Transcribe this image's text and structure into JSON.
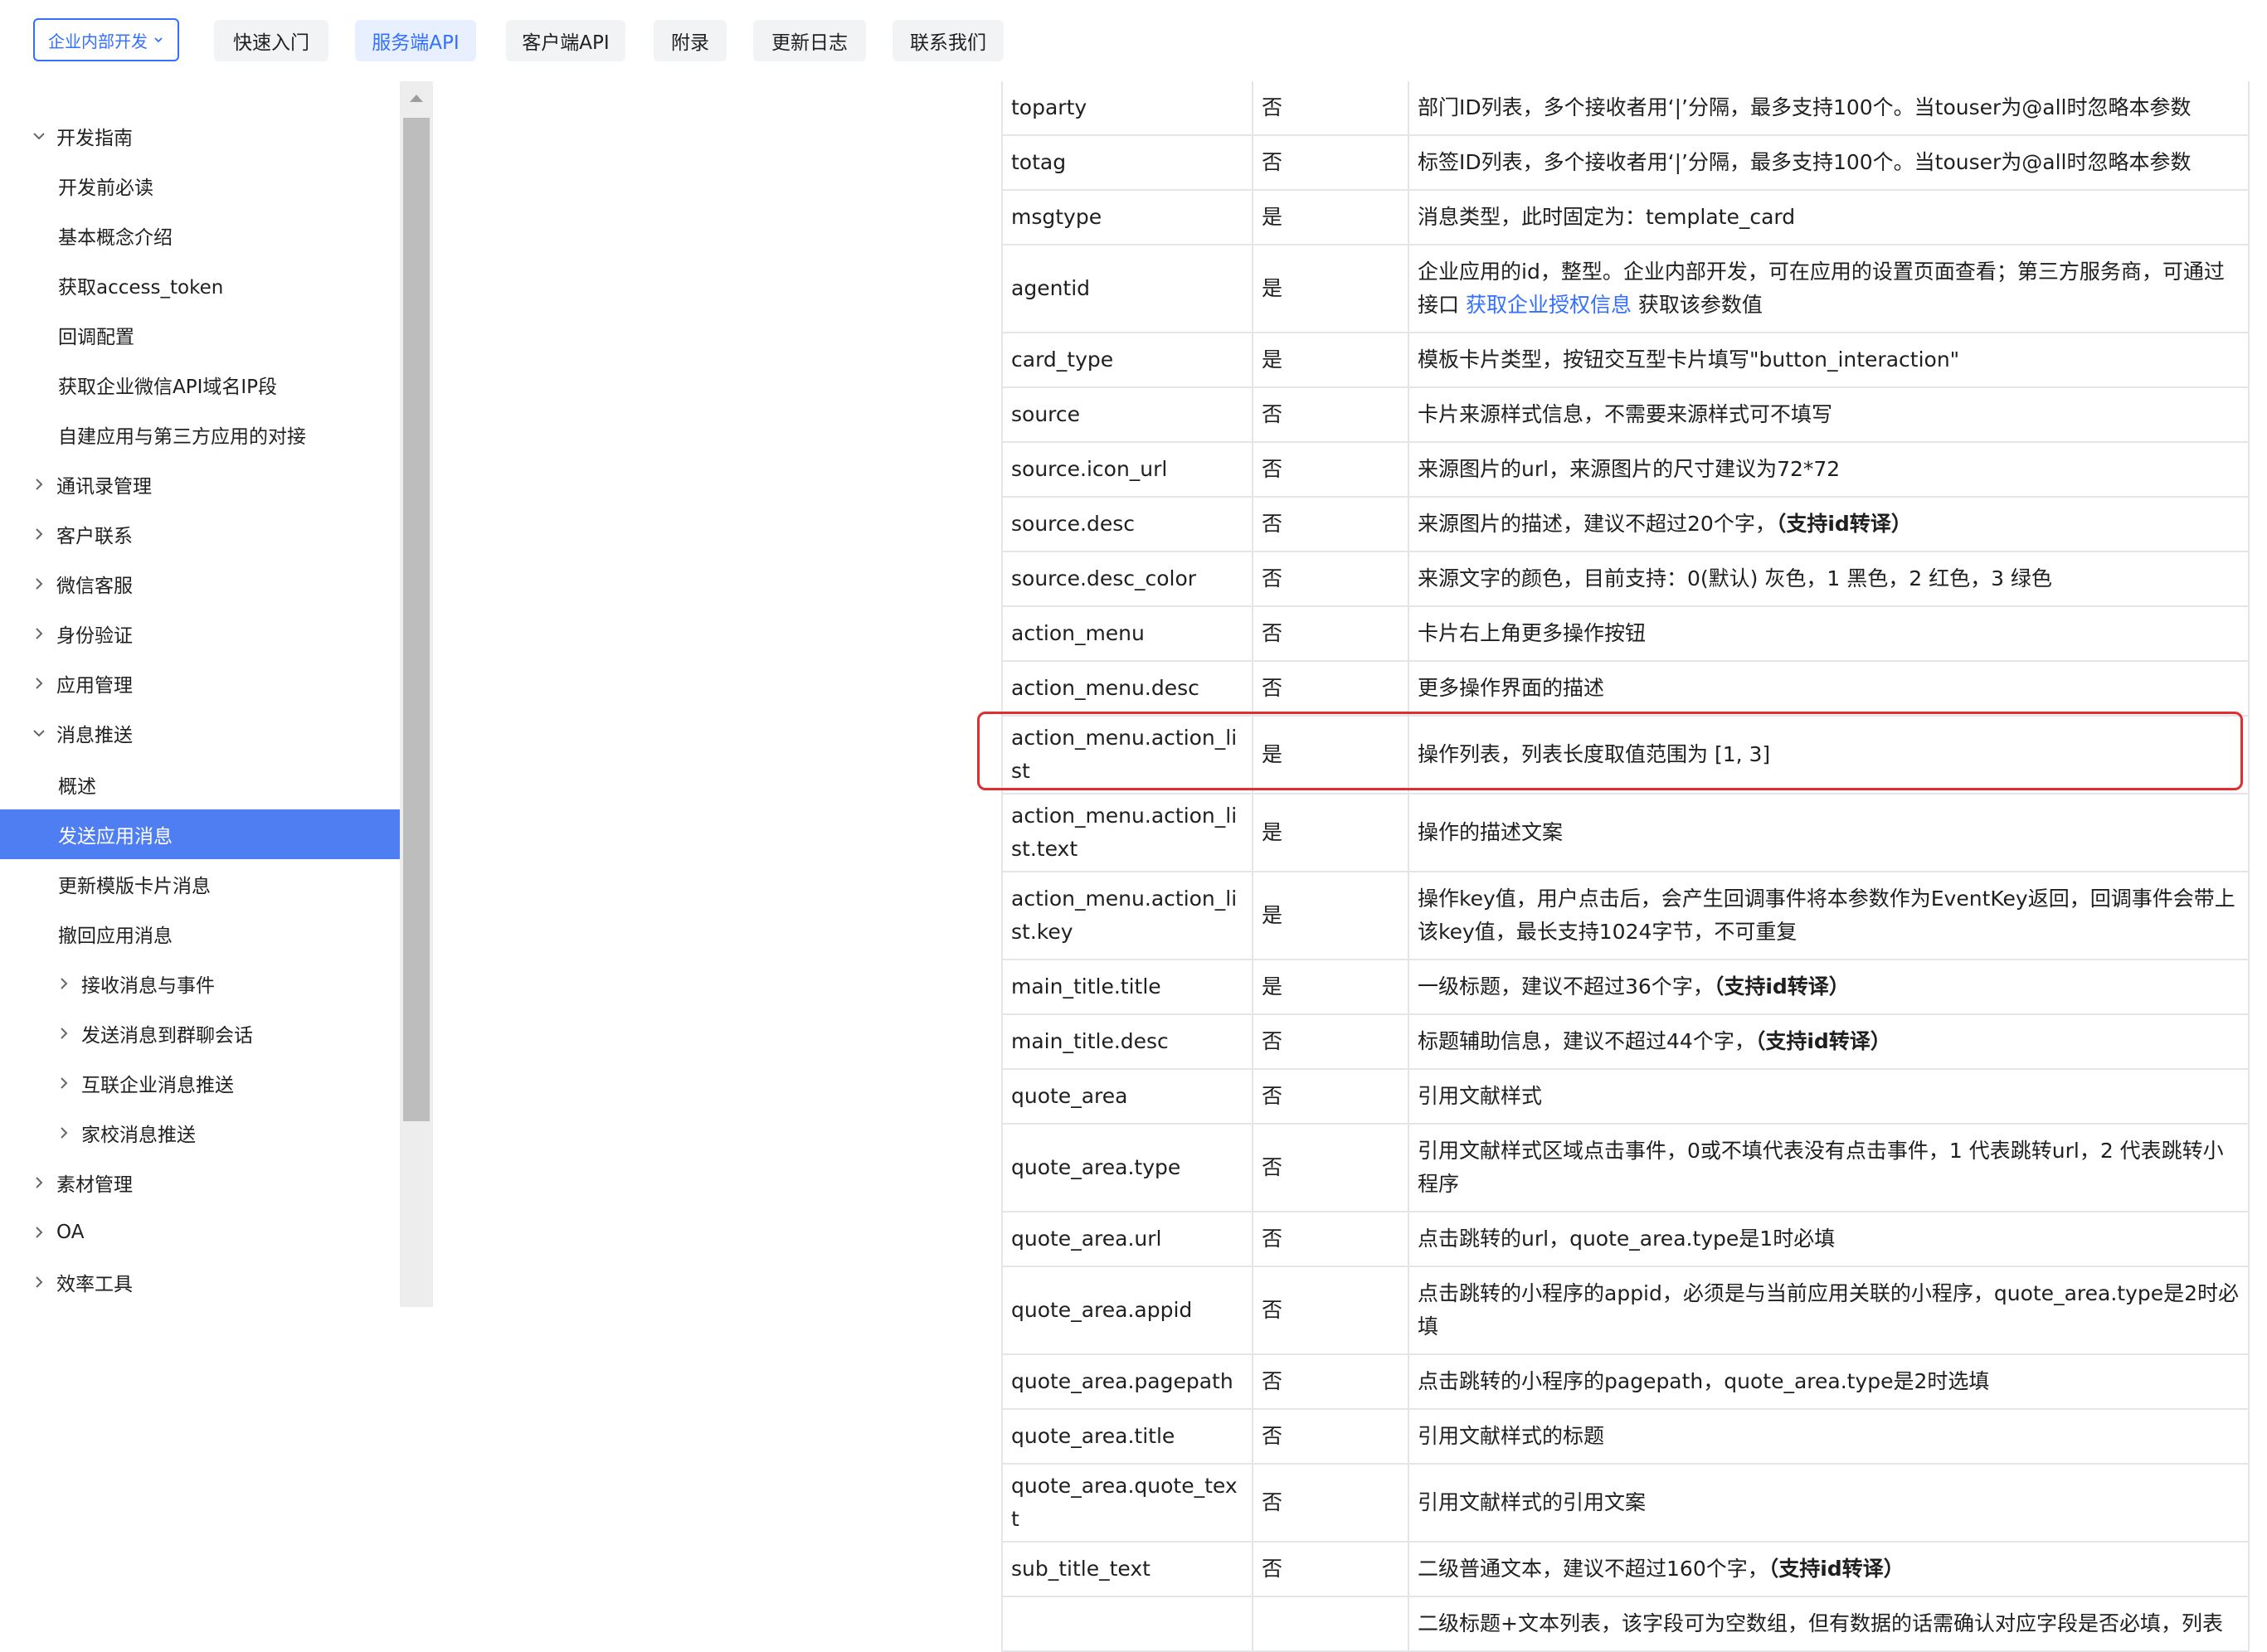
{
  "topnav": {
    "dropdown_label": "企业内部开发",
    "tabs": [
      {
        "label": "快速入门"
      },
      {
        "label": "服务端API"
      },
      {
        "label": "客户端API"
      },
      {
        "label": "附录"
      },
      {
        "label": "更新日志"
      },
      {
        "label": "联系我们"
      }
    ],
    "active_tab": "服务端API"
  },
  "sidebar": {
    "items": [
      {
        "label": "开发指南",
        "expanded": true
      },
      {
        "label": "开发前必读"
      },
      {
        "label": "基本概念介绍"
      },
      {
        "label": "获取access_token"
      },
      {
        "label": "回调配置"
      },
      {
        "label": "获取企业微信API域名IP段"
      },
      {
        "label": "自建应用与第三方应用的对接"
      },
      {
        "label": "通讯录管理",
        "expanded": false
      },
      {
        "label": "客户联系",
        "expanded": false
      },
      {
        "label": "微信客服",
        "expanded": false
      },
      {
        "label": "身份验证",
        "expanded": false
      },
      {
        "label": "应用管理",
        "expanded": false
      },
      {
        "label": "消息推送",
        "expanded": true
      },
      {
        "label": "概述"
      },
      {
        "label": "发送应用消息",
        "selected": true
      },
      {
        "label": "更新模版卡片消息"
      },
      {
        "label": "撤回应用消息"
      },
      {
        "label": "接收消息与事件",
        "expanded": false
      },
      {
        "label": "发送消息到群聊会话",
        "expanded": false
      },
      {
        "label": "互联企业消息推送",
        "expanded": false
      },
      {
        "label": "家校消息推送",
        "expanded": false
      },
      {
        "label": "素材管理",
        "expanded": false
      },
      {
        "label": "OA",
        "expanded": false
      },
      {
        "label": "效率工具",
        "expanded": false
      }
    ]
  },
  "table": {
    "rows": [
      {
        "param": "toparty",
        "required": "否",
        "desc": "部门ID列表，多个接收者用‘|’分隔，最多支持100个。当touser为@all时忽略本参数"
      },
      {
        "param": "totag",
        "required": "否",
        "desc": "标签ID列表，多个接收者用‘|’分隔，最多支持100个。当touser为@all时忽略本参数"
      },
      {
        "param": "msgtype",
        "required": "是",
        "desc": "消息类型，此时固定为：template_card"
      },
      {
        "param": "agentid",
        "required": "是",
        "desc": "企业应用的id，整型。企业内部开发，可在应用的设置页面查看；第三方服务商，可通过接口 ",
        "desc_link": "获取企业授权信息",
        "desc_tail": " 获取该参数值"
      },
      {
        "param": "card_type",
        "required": "是",
        "desc": "模板卡片类型，按钮交互型卡片填写\"button_interaction\""
      },
      {
        "param": "source",
        "required": "否",
        "desc": "卡片来源样式信息，不需要来源样式可不填写"
      },
      {
        "param": "source.icon_url",
        "required": "否",
        "desc": "来源图片的url，来源图片的尺寸建议为72*72"
      },
      {
        "param": "source.desc",
        "required": "否",
        "desc": "来源图片的描述，建议不超过20个字，",
        "desc_bold": "（支持id转译）"
      },
      {
        "param": "source.desc_color",
        "required": "否",
        "desc": "来源文字的颜色，目前支持：0(默认) 灰色，1 黑色，2 红色，3 绿色"
      },
      {
        "param": "action_menu",
        "required": "否",
        "desc": "卡片右上角更多操作按钮"
      },
      {
        "param": "action_menu.desc",
        "required": "否",
        "desc": "更多操作界面的描述"
      },
      {
        "param": "action_menu.action_list",
        "required": "是",
        "desc": "操作列表，列表长度取值范围为 [1, 3]"
      },
      {
        "param": "action_menu.action_list.text",
        "required": "是",
        "desc": "操作的描述文案"
      },
      {
        "param": "action_menu.action_list.key",
        "required": "是",
        "desc": "操作key值，用户点击后，会产生回调事件将本参数作为EventKey返回，回调事件会带上该key值，最长支持1024字节，不可重复",
        "highlighted": true
      },
      {
        "param": "main_title.title",
        "required": "是",
        "desc": "一级标题，建议不超过36个字，",
        "desc_bold": "（支持id转译）"
      },
      {
        "param": "main_title.desc",
        "required": "否",
        "desc": "标题辅助信息，建议不超过44个字，",
        "desc_bold": "（支持id转译）"
      },
      {
        "param": "quote_area",
        "required": "否",
        "desc": "引用文献样式"
      },
      {
        "param": "quote_area.type",
        "required": "否",
        "desc": "引用文献样式区域点击事件，0或不填代表没有点击事件，1 代表跳转url，2 代表跳转小程序"
      },
      {
        "param": "quote_area.url",
        "required": "否",
        "desc": "点击跳转的url，quote_area.type是1时必填"
      },
      {
        "param": "quote_area.appid",
        "required": "否",
        "desc": "点击跳转的小程序的appid，必须是与当前应用关联的小程序，quote_area.type是2时必填"
      },
      {
        "param": "quote_area.pagepath",
        "required": "否",
        "desc": "点击跳转的小程序的pagepath，quote_area.type是2时选填"
      },
      {
        "param": "quote_area.title",
        "required": "否",
        "desc": "引用文献样式的标题"
      },
      {
        "param": "quote_area.quote_text",
        "required": "否",
        "desc": "引用文献样式的引用文案"
      },
      {
        "param": "sub_title_text",
        "required": "否",
        "desc": "二级普通文本，建议不超过160个字，",
        "desc_bold": "（支持id转译）"
      },
      {
        "param": "",
        "required": "",
        "desc": "二级标题+文本列表，该字段可为空数组，但有数据的话需确认对应字段是否必填，列表"
      }
    ]
  },
  "colors": {
    "accent": "#3370ff",
    "selected_bg": "#4f7ef2",
    "highlight_border": "#e02d2d"
  }
}
